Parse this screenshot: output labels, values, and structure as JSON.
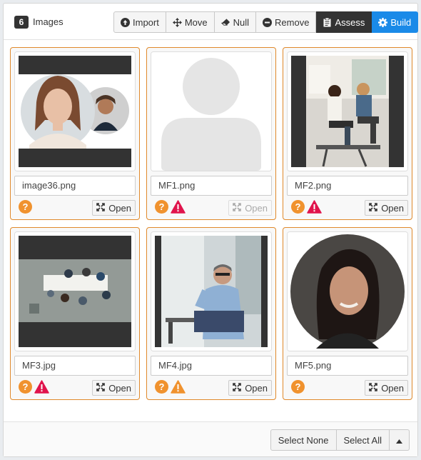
{
  "header": {
    "count": "6",
    "title": "Images"
  },
  "toolbar": {
    "import_label": "Import",
    "move_label": "Move",
    "null_label": "Null",
    "remove_label": "Remove",
    "assess_label": "Assess",
    "build_label": "Build"
  },
  "images": [
    {
      "name": "image36.png",
      "open_label": "Open",
      "open_enabled": true,
      "statuses": [
        "question"
      ]
    },
    {
      "name": "MF1.png",
      "open_label": "Open",
      "open_enabled": false,
      "statuses": [
        "question",
        "warning"
      ]
    },
    {
      "name": "MF2.png",
      "open_label": "Open",
      "open_enabled": true,
      "statuses": [
        "question",
        "warning"
      ]
    },
    {
      "name": "MF3.jpg",
      "open_label": "Open",
      "open_enabled": true,
      "statuses": [
        "question",
        "warning"
      ]
    },
    {
      "name": "MF4.jpg",
      "open_label": "Open",
      "open_enabled": true,
      "statuses": [
        "question",
        "caution"
      ]
    },
    {
      "name": "MF5.png",
      "open_label": "Open",
      "open_enabled": true,
      "statuses": [
        "question"
      ]
    }
  ],
  "footer": {
    "select_none_label": "Select None",
    "select_all_label": "Select All"
  },
  "colors": {
    "question": "#f0922e",
    "warning": "#e0144c",
    "caution": "#f0922e",
    "card_border": "#e0892b",
    "primary": "#1a8ae8"
  }
}
